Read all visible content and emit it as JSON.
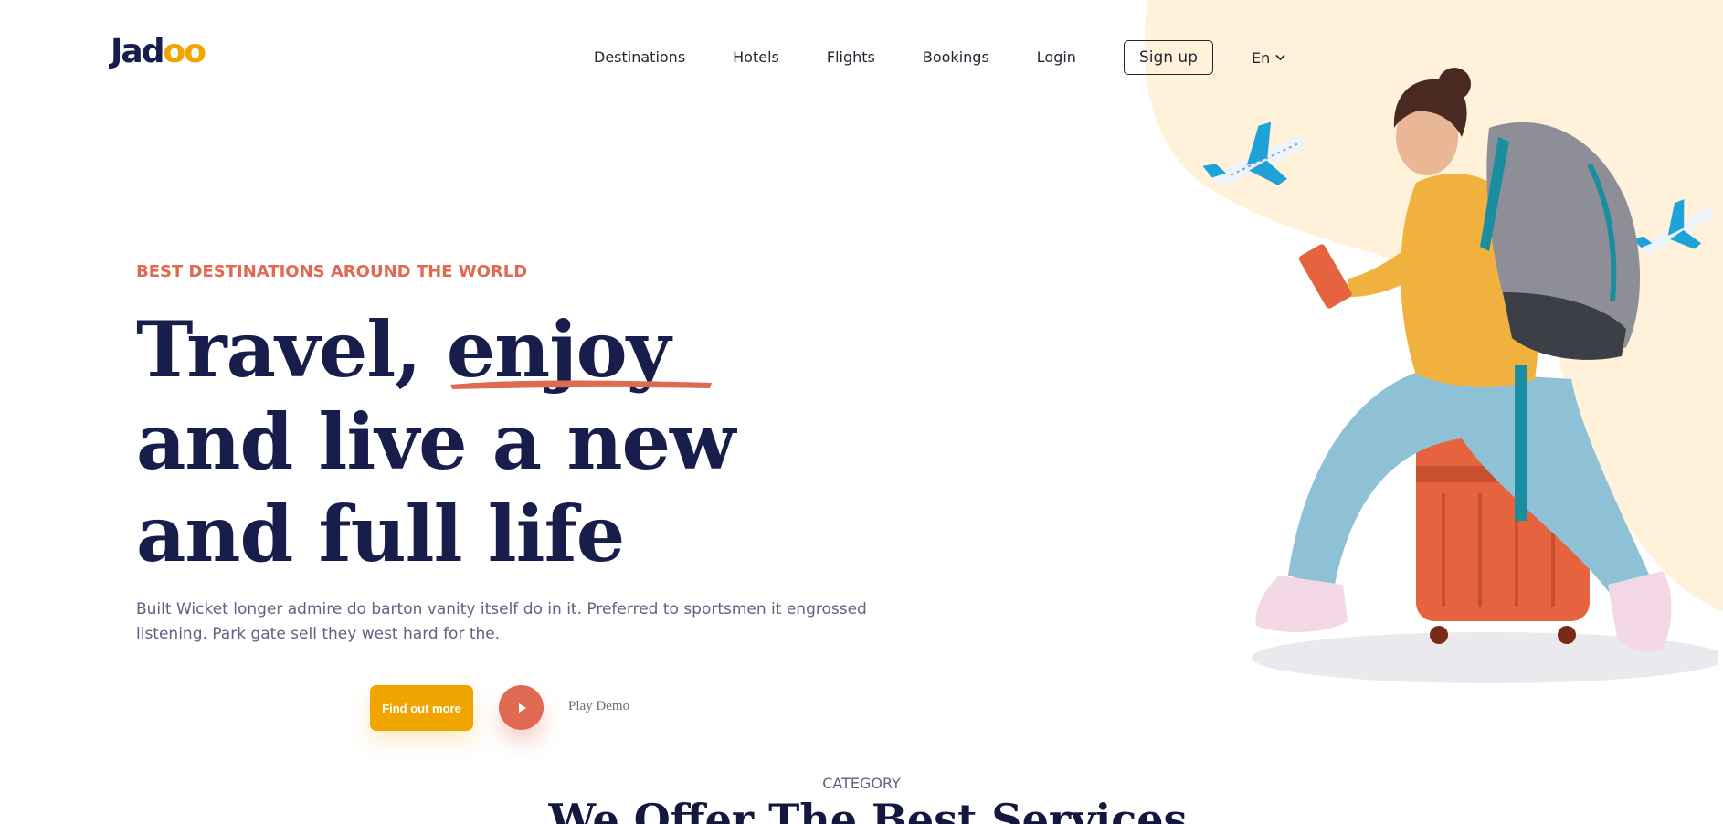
{
  "brand": {
    "logo_prefix": "Jad",
    "logo_suffix": "oo"
  },
  "nav": {
    "items": [
      {
        "label": "Destinations"
      },
      {
        "label": "Hotels"
      },
      {
        "label": "Flights"
      },
      {
        "label": "Bookings"
      },
      {
        "label": "Login"
      }
    ],
    "signup_label": "Sign up",
    "language": "En"
  },
  "hero": {
    "eyebrow": "BEST DESTINATIONS AROUND THE WORLD",
    "headline_before": "Travel, ",
    "headline_highlight": "enjoy",
    "headline_after": " and live a new and full life",
    "description": "Built Wicket longer admire do barton vanity itself do in it. Preferred to sportsmen it engrossed listening. Park gate sell they west hard for the.",
    "cta_label": "Find out more",
    "play_label": "Play Demo"
  },
  "category": {
    "label": "CATEGORY",
    "title": "We Offer The Best Services"
  },
  "colors": {
    "accent_orange": "#DF6951",
    "accent_yellow": "#F1A501",
    "navy": "#181E4B",
    "blob": "#FFF1DA"
  },
  "icons": [
    "chevron-down-icon",
    "play-icon"
  ]
}
